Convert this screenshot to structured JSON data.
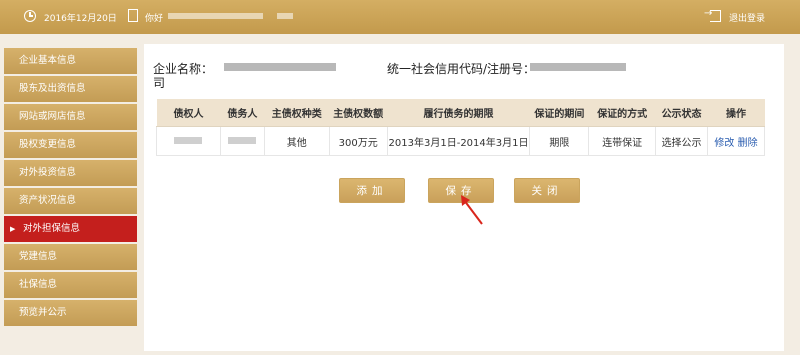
{
  "header": {
    "date": "2016年12月20日",
    "user_label": "你好",
    "logout_label": "退出登录"
  },
  "sidebar": {
    "items": [
      {
        "label": "企业基本信息"
      },
      {
        "label": "股东及出资信息"
      },
      {
        "label": "网站或网店信息"
      },
      {
        "label": "股权变更信息"
      },
      {
        "label": "对外投资信息"
      },
      {
        "label": "资产状况信息"
      },
      {
        "label": "对外担保信息",
        "active": true
      },
      {
        "label": "党建信息"
      },
      {
        "label": "社保信息"
      },
      {
        "label": "预览并公示"
      }
    ]
  },
  "main": {
    "company_name_label": "企业名称：",
    "company_name_suffix": "司",
    "credit_code_label": "统一社会信用代码/注册号："
  },
  "table": {
    "headers": [
      "债权人",
      "债务人",
      "主债权种类",
      "主债权数额",
      "履行债务的期限",
      "保证的期间",
      "保证的方式",
      "公示状态",
      "操作"
    ],
    "rows": [
      {
        "creditor": "",
        "debtor": "",
        "claim_type": "其他",
        "claim_amount": "300万元",
        "term": "2013年3月1日-2014年3月1日",
        "guarantee_period": "期限",
        "guarantee_method": "连带保证",
        "public_status": "选择公示",
        "action_edit": "修改",
        "action_delete": "删除"
      }
    ]
  },
  "buttons": {
    "add": "添加",
    "save": "保存",
    "close": "关闭"
  },
  "colors": {
    "gold": "#c9a05a",
    "active_red": "#c41f1d",
    "arrow_red": "#d9261c"
  }
}
